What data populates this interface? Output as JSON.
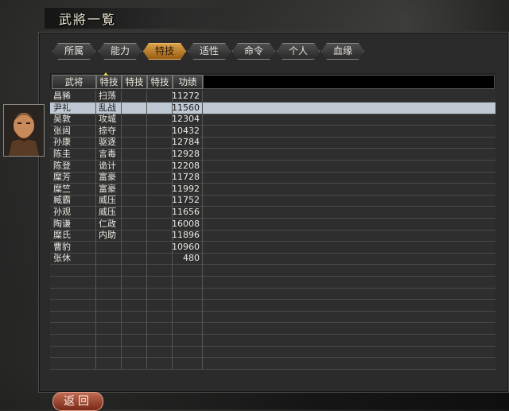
{
  "window": {
    "title": "武將一覧"
  },
  "tabs": [
    {
      "label": "所属",
      "active": false
    },
    {
      "label": "能力",
      "active": false
    },
    {
      "label": "特技",
      "active": true
    },
    {
      "label": "适性",
      "active": false
    },
    {
      "label": "命令",
      "active": false
    },
    {
      "label": "个人",
      "active": false
    },
    {
      "label": "血缘",
      "active": false
    }
  ],
  "table": {
    "headers": [
      "武将",
      "特技",
      "特技",
      "特技",
      "功绩"
    ],
    "sorted_column": "特技",
    "rows": [
      {
        "name": "昌豨",
        "skill1": "扫荡",
        "merit": "11272",
        "selected": false
      },
      {
        "name": "尹礼",
        "skill1": "乱战",
        "merit": "11560",
        "selected": true
      },
      {
        "name": "吴敦",
        "skill1": "攻城",
        "merit": "12304",
        "selected": false
      },
      {
        "name": "张闿",
        "skill1": "掠夺",
        "merit": "10432",
        "selected": false
      },
      {
        "name": "孙康",
        "skill1": "驱逐",
        "merit": "12784",
        "selected": false
      },
      {
        "name": "陈圭",
        "skill1": "言毒",
        "merit": "12928",
        "selected": false
      },
      {
        "name": "陈登",
        "skill1": "诡计",
        "merit": "12208",
        "selected": false
      },
      {
        "name": "糜芳",
        "skill1": "富豪",
        "merit": "11728",
        "selected": false
      },
      {
        "name": "糜竺",
        "skill1": "富豪",
        "merit": "11992",
        "selected": false
      },
      {
        "name": "臧霸",
        "skill1": "威压",
        "merit": "11752",
        "selected": false
      },
      {
        "name": "孙观",
        "skill1": "威压",
        "merit": "11656",
        "selected": false
      },
      {
        "name": "陶谦",
        "skill1": "仁政",
        "merit": "16008",
        "selected": false
      },
      {
        "name": "糜氏",
        "skill1": "内助",
        "merit": "11896",
        "selected": false
      },
      {
        "name": "曹豹",
        "skill1": "",
        "merit": "10960",
        "selected": false
      },
      {
        "name": "张休",
        "skill1": "",
        "merit": "480",
        "selected": false
      }
    ],
    "empty_rows": 9
  },
  "portrait": {
    "icon": "general-portrait"
  },
  "footer": {
    "back_label": "返回"
  },
  "colors": {
    "selected_row": "#bfc9d3",
    "active_tab": "#c0822a",
    "back_button": "#a0402c"
  }
}
